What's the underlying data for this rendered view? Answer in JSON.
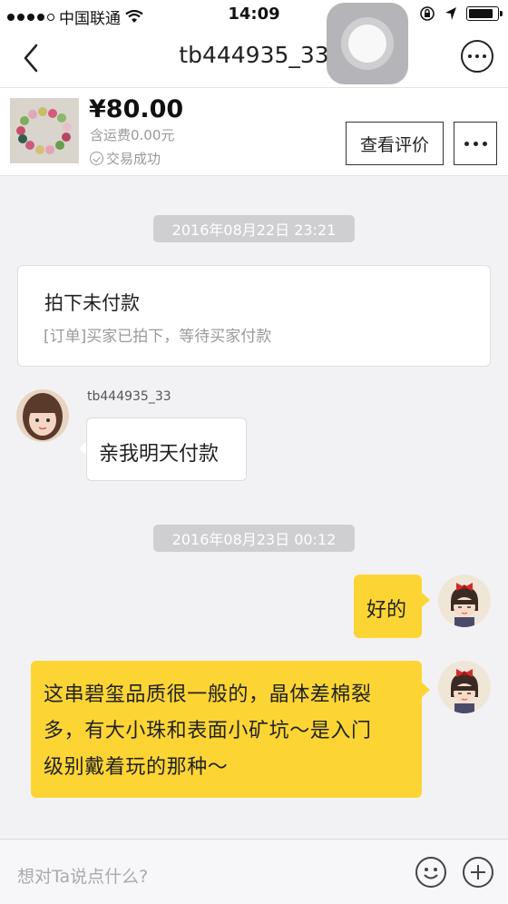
{
  "status_bar": {
    "carrier": "中国联通",
    "time": "14:09",
    "battery_level": 0.85
  },
  "nav": {
    "title": "tb444935_33"
  },
  "product": {
    "price": "¥80.00",
    "shipping": "含运费0.00元",
    "status": "交易成功",
    "review_button": "查看评价"
  },
  "messages": {
    "date1": "2016年08月22日  23:21",
    "order_title": "拍下未付款",
    "order_subtitle": "[订单]买家已拍下，等待买家付款",
    "buyer_name": "tb444935_33",
    "buyer_msg": "亲我明天付款",
    "date2": "2016年08月23日  00:12",
    "seller_msg1": "好的",
    "seller_msg2_lines": [
      "这串碧玺品质很一般的，晶体差棉裂",
      "多，有大小珠和表面小矿坑～是入门",
      "级别戴着玩的那种～"
    ]
  },
  "input": {
    "placeholder": "想对Ta说点什么?"
  },
  "colors": {
    "accent_yellow": "#fcd534",
    "background": "#f2f2f4"
  },
  "icons": [
    "signal-dots-icon",
    "wifi-icon",
    "lock-rotation-icon",
    "location-arrow-icon",
    "battery-icon",
    "back-chevron-icon",
    "more-dots-icon",
    "check-circle-icon",
    "emoji-icon",
    "plus-icon"
  ]
}
